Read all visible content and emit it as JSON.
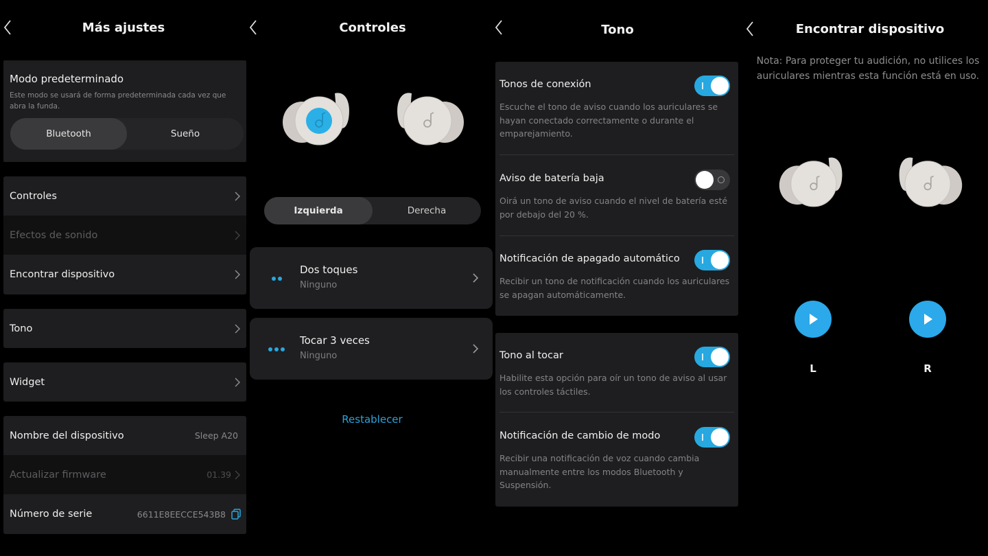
{
  "colors": {
    "accent": "#27a8e0",
    "background": "#000000",
    "card": "#1e1e20"
  },
  "screens": [
    {
      "title": "Más ajustes",
      "default_mode": {
        "title": "Modo predeterminado",
        "description": "Este modo se usará de forma predeterminada cada vez que abra la funda.",
        "options": [
          "Bluetooth",
          "Sueño"
        ],
        "selected": "Bluetooth"
      },
      "rows": [
        {
          "label": "Controles",
          "enabled": true
        },
        {
          "label": "Efectos de sonido",
          "enabled": false
        },
        {
          "label": "Encontrar dispositivo",
          "enabled": true
        },
        {
          "label": "Tono",
          "enabled": true
        },
        {
          "label": "Widget",
          "enabled": true
        },
        {
          "label": "Nombre del dispositivo",
          "value": "Sleep A20",
          "enabled": true
        },
        {
          "label": "Actualizar firmware",
          "value": "01.39",
          "enabled": false
        },
        {
          "label": "Número de serie",
          "value": "6611E8EECCE543B8",
          "enabled": true,
          "icon": "copy-icon"
        }
      ]
    },
    {
      "title": "Controles",
      "side_options": [
        "Izquierda",
        "Derecha"
      ],
      "selected_side": "Izquierda",
      "gestures": [
        {
          "title": "Dos toques",
          "value": "Ninguno",
          "icon": "double-tap-icon"
        },
        {
          "title": "Tocar 3 veces",
          "value": "Ninguno",
          "icon": "triple-tap-icon"
        }
      ],
      "reset_label": "Restablecer"
    },
    {
      "title": "Tono",
      "groups": [
        [
          {
            "title": "Tonos de conexión",
            "description": "Escuche el tono de aviso cuando los auriculares se hayan conectado correctamente o durante el emparejamiento.",
            "on": true
          },
          {
            "title": "Aviso de batería baja",
            "description": "Oirá un tono de aviso cuando el nivel de batería esté por debajo del 20 %.",
            "on": false
          },
          {
            "title": "Notificación de apagado automático",
            "description": "Recibir un tono de notificación cuando los auriculares se apagan automáticamente.",
            "on": true
          }
        ],
        [
          {
            "title": "Tono al tocar",
            "description": "Habilite esta opción para oír un tono de aviso al usar los controles táctiles.",
            "on": true
          },
          {
            "title": "Notificación de cambio de modo",
            "description": "Recibir una notificación de voz cuando cambia manualmente entre los modos Bluetooth y Suspensión.",
            "on": true
          }
        ]
      ]
    },
    {
      "title": "Encontrar dispositivo",
      "note": "Nota: Para proteger tu audición, no utilices los auriculares mientras esta función está en uso.",
      "left_label": "L",
      "right_label": "R"
    }
  ]
}
